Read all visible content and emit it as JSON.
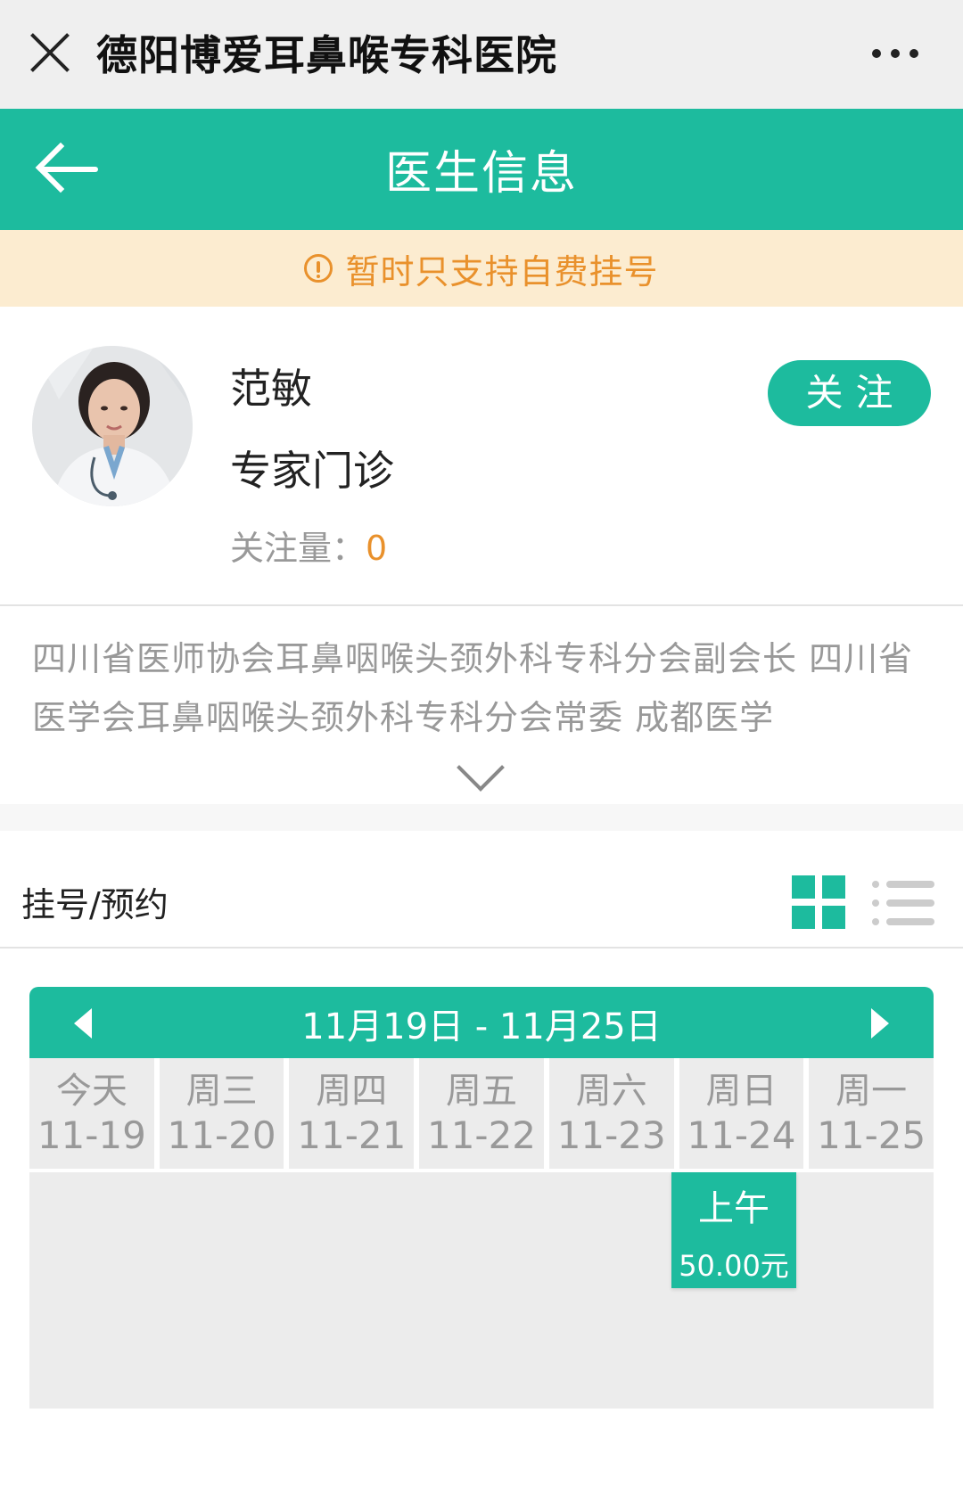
{
  "wechat_bar": {
    "title": "德阳博爱耳鼻喉专科医院"
  },
  "header": {
    "title": "医生信息"
  },
  "notice": {
    "text": "暂时只支持自费挂号"
  },
  "doctor": {
    "name": "范敏",
    "department": "专家门诊",
    "follow_count_label": "关注量：",
    "follow_count": "0",
    "follow_button": "关注",
    "intro": "四川省医师协会耳鼻咽喉头颈外科专科分会副会长 四川省医学会耳鼻咽喉头颈外科专科分会常委 成都医学"
  },
  "booking": {
    "title": "挂号/预约",
    "date_range": "11月19日 - 11月25日",
    "days": [
      {
        "weekday": "今天",
        "date": "11-19"
      },
      {
        "weekday": "周三",
        "date": "11-20"
      },
      {
        "weekday": "周四",
        "date": "11-21"
      },
      {
        "weekday": "周五",
        "date": "11-22"
      },
      {
        "weekday": "周六",
        "date": "11-23"
      },
      {
        "weekday": "周日",
        "date": "11-24"
      },
      {
        "weekday": "周一",
        "date": "11-25"
      }
    ],
    "slot": {
      "day": "周日",
      "period": "上午",
      "price": "50.00元"
    }
  },
  "icons": {
    "close": "close-icon",
    "more": "more-dots-icon",
    "back": "back-arrow-icon",
    "notice": "alert-circle-icon",
    "expand": "chevron-down-icon",
    "grid_view": "grid-view-icon",
    "list_view": "list-view-icon",
    "prev_week": "triangle-left-icon",
    "next_week": "triangle-right-icon"
  },
  "colors": {
    "accent": "#1dbb9e",
    "warning": "#e9912c",
    "notice_bg": "#fcecd0"
  }
}
